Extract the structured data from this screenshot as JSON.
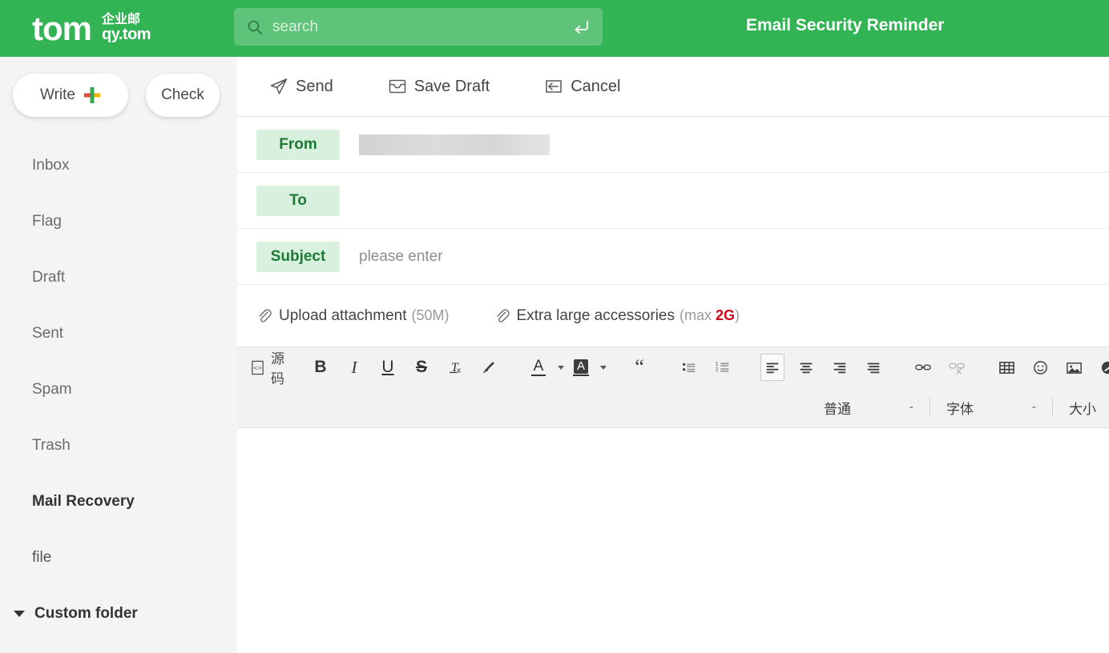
{
  "header": {
    "brand_name": "tom",
    "brand_cn_top": "企业邮",
    "brand_cn_bottom": "qy.tom",
    "title": "Email Security Reminder",
    "bg_color": "#32b354",
    "search": {
      "placeholder": "search",
      "value": "",
      "icon": "search-icon",
      "enter_icon": "enter-return-icon"
    }
  },
  "sidebar": {
    "write_button": "Write",
    "check_button": "Check",
    "items": [
      {
        "label": "Inbox",
        "style": "normal"
      },
      {
        "label": "Flag",
        "style": "normal"
      },
      {
        "label": "Draft",
        "style": "normal"
      },
      {
        "label": "Sent",
        "style": "normal"
      },
      {
        "label": "Spam",
        "style": "normal"
      },
      {
        "label": "Trash",
        "style": "normal"
      },
      {
        "label": "Mail Recovery",
        "style": "bold"
      },
      {
        "label": "file",
        "style": "normal"
      },
      {
        "label": "Custom folder",
        "style": "bold"
      }
    ]
  },
  "compose": {
    "actions": [
      {
        "label": "Send",
        "icon": "paper-plane-icon"
      },
      {
        "label": "Save Draft",
        "icon": "inbox-tray-icon"
      },
      {
        "label": "Cancel",
        "icon": "back-arrow-icon"
      }
    ],
    "fields": [
      {
        "label": "From",
        "value": "",
        "placeholder": "",
        "redacted": true
      },
      {
        "label": "To",
        "value": "",
        "placeholder": "",
        "redacted": false
      },
      {
        "label": "Subject",
        "value": "",
        "placeholder": "please enter",
        "redacted": false
      }
    ],
    "attachments": [
      {
        "label": "Upload attachment",
        "note_prefix": "(50M)",
        "note_hot": "",
        "note_suffix": "",
        "icon": "paperclip-icon"
      },
      {
        "label": "Extra large accessories",
        "note_prefix": "(max ",
        "note_hot": "2G",
        "note_suffix": ")",
        "icon": "paperclip-icon"
      }
    ]
  },
  "editor": {
    "source_label": "源码",
    "tools": {
      "bold": "B",
      "italic": "I",
      "underline": "U",
      "strike": "S",
      "remove_format": "Tx",
      "brush": "brush-icon",
      "text_color": "A",
      "bg_color": "A",
      "quote": "“",
      "bullet_list": "bulleted-list-icon",
      "numbered_list": "numbered-list-icon",
      "align_left": "align-left-icon",
      "align_center": "align-center-icon",
      "align_right": "align-right-icon",
      "align_justify": "align-justify-icon",
      "link": "link-icon",
      "unlink": "unlink-icon",
      "table": "table-icon",
      "emoji": "emoji-icon",
      "image": "image-icon",
      "media": "media-icon"
    },
    "selects": [
      {
        "label": "普通"
      },
      {
        "label": "字体"
      },
      {
        "label": "大小"
      }
    ],
    "body_value": ""
  }
}
